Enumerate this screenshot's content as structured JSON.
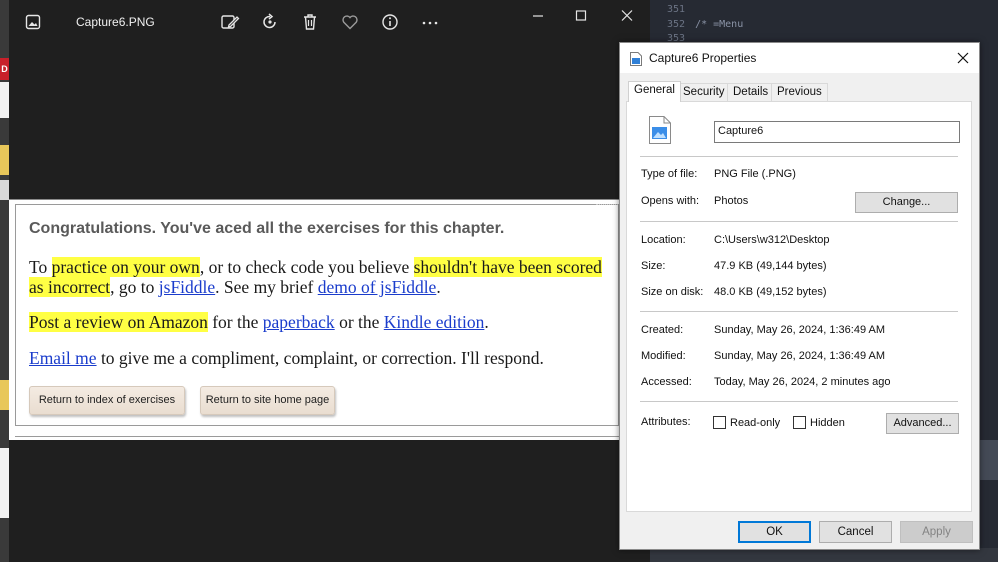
{
  "editor": {
    "lines": [
      {
        "num": "351",
        "text": ""
      },
      {
        "num": "352",
        "text": "/* =Menu"
      },
      {
        "num": "353",
        "text": ""
      }
    ]
  },
  "left_strip": {
    "red_label": "D"
  },
  "photos": {
    "title": "Capture6.PNG",
    "toolbar": [
      "edit-image-icon",
      "rotate-icon",
      "delete-icon",
      "favorite-icon",
      "info-icon",
      "more-icon"
    ],
    "image": {
      "heading": "Congratulations. You've aced all the exercises for this chapter.",
      "p1": {
        "t1": "To ",
        "h1": "practice on your own",
        "t2": ", or to check code you believe ",
        "h2": "shouldn't have been scored as incorrect",
        "t3": ", go to ",
        "l1": "jsFiddle",
        "t4": ". See my brief ",
        "l2": "demo of jsFiddle",
        "t5": "."
      },
      "p2": {
        "h1": "Post a review on Amazon",
        "t1": " for the ",
        "l1": "paperback",
        "t2": " or the ",
        "l2": "Kindle edition",
        "t3": "."
      },
      "p3": {
        "l1": "Email me",
        "t1": " to give me a compliment, complaint, or correction. I'll respond."
      },
      "buttons": [
        "Return to index of exercises",
        "Return to site home page"
      ]
    }
  },
  "dialog": {
    "title": "Capture6 Properties",
    "tabs": [
      "General",
      "Security",
      "Details",
      "Previous Versions"
    ],
    "file_name": "Capture6",
    "rows": {
      "type_label": "Type of file:",
      "type_value": "PNG File (.PNG)",
      "opens_label": "Opens with:",
      "opens_value": "Photos",
      "change_button": "Change...",
      "location_label": "Location:",
      "location_value": "C:\\Users\\w312\\Desktop",
      "size_label": "Size:",
      "size_value": "47.9 KB (49,144 bytes)",
      "disk_label": "Size on disk:",
      "disk_value": "48.0 KB (49,152 bytes)",
      "created_label": "Created:",
      "created_value": "Sunday, May 26, 2024, 1:36:49 AM",
      "modified_label": "Modified:",
      "modified_value": "Sunday, May 26, 2024, 1:36:49 AM",
      "accessed_label": "Accessed:",
      "accessed_value": "Today, May 26, 2024, 2 minutes ago",
      "attributes_label": "Attributes:",
      "readonly_label": "Read-only",
      "hidden_label": "Hidden",
      "advanced_button": "Advanced..."
    },
    "footer": {
      "ok": "OK",
      "cancel": "Cancel",
      "apply": "Apply"
    },
    "accent": "#0078d7"
  }
}
